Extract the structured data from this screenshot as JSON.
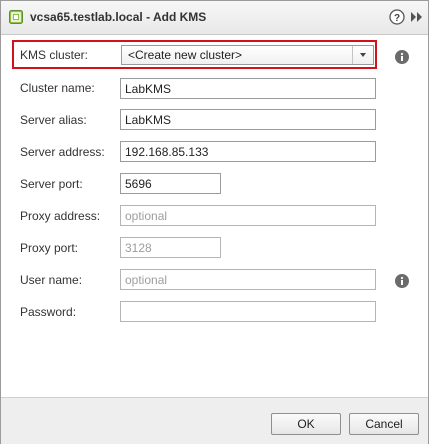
{
  "window": {
    "title": "vcsa65.testlab.local - Add KMS",
    "app_icon": "vsphere-icon",
    "help_icon": "help-icon",
    "expand_icon": "expand-icon"
  },
  "form": {
    "kms_cluster": {
      "label": "KMS cluster:",
      "selected": "<Create new cluster>"
    },
    "cluster_name": {
      "label": "Cluster name:",
      "value": "LabKMS"
    },
    "server_alias": {
      "label": "Server alias:",
      "value": "LabKMS"
    },
    "server_address": {
      "label": "Server address:",
      "value": "192.168.85.133"
    },
    "server_port": {
      "label": "Server port:",
      "value": "5696"
    },
    "proxy_address": {
      "label": "Proxy address:",
      "value": "",
      "placeholder": "optional"
    },
    "proxy_port": {
      "label": "Proxy port:",
      "value": "",
      "placeholder": "3128"
    },
    "user_name": {
      "label": "User name:",
      "value": "",
      "placeholder": "optional"
    },
    "password": {
      "label": "Password:",
      "value": ""
    }
  },
  "footer": {
    "ok_label": "OK",
    "cancel_label": "Cancel"
  },
  "colors": {
    "highlight": "#d2121b",
    "info_icon": "#6b6b6b"
  }
}
